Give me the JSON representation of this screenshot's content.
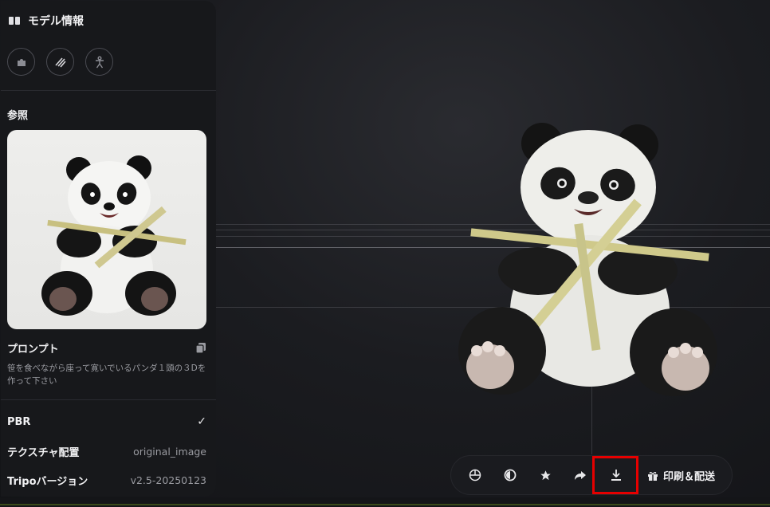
{
  "panel": {
    "title": "モデル情報",
    "title_icon": "book-icon",
    "mode_icons": [
      "puzzle-icon",
      "texture-lines-icon",
      "figure-pose-icon"
    ],
    "reference_title": "参照",
    "prompt_title": "プロンプト",
    "prompt_text": "笹を食べながら座って寛いでいるパンダ１頭の３Dを作って下さい",
    "copy_icon": "copy-icon",
    "props": [
      {
        "label": "PBR",
        "value": "✓"
      },
      {
        "label": "テクスチャ配置",
        "value": "original_image"
      },
      {
        "label": "Tripoバージョン",
        "value": "v2.5-20250123"
      }
    ]
  },
  "toolbar": {
    "buttons": [
      "sphere-view-icon",
      "half-circle-icon",
      "star-icon",
      "share-arrow-icon",
      "download-icon"
    ],
    "print_label": "印刷＆配送",
    "print_icon": "gift-icon"
  },
  "colors": {
    "panel_bg": "#17181b",
    "highlight": "#e60000"
  }
}
